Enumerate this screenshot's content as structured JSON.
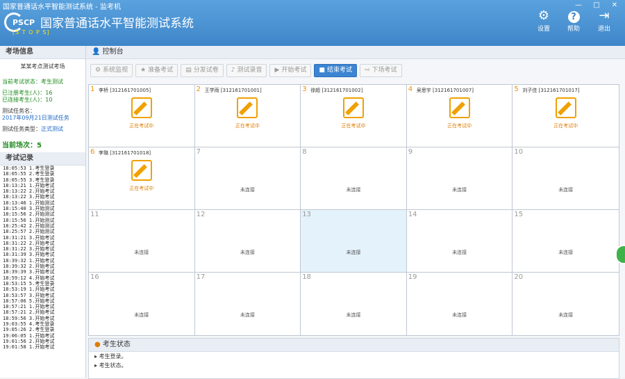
{
  "window": {
    "title": "国家普通话水平智能测试系统 - 监考机",
    "min": "—",
    "max": "□",
    "close": "✕"
  },
  "app": {
    "logo": "PSCP",
    "title": "国家普通话水平智能测试系统",
    "subtitle": "[S T O P S]"
  },
  "header_buttons": [
    {
      "label": "设置",
      "icon": "gear-icon",
      "glyph": "⚙"
    },
    {
      "label": "帮助",
      "icon": "help-icon",
      "glyph": "?"
    },
    {
      "label": "退出",
      "icon": "exit-icon",
      "glyph": "⇥"
    }
  ],
  "left": {
    "section_title": "考场信息",
    "room_name": "某某考点测试考场",
    "status_label": "当前考试状态：考生测试",
    "registered": "已注册考生(人)：16",
    "connected": "已连接考生(人)：10",
    "task_label": "测试任务名：",
    "task_value": "2017年09月21日测试任务",
    "type_label": "测试任务类型：",
    "type_value": "正式测试",
    "current_session": "当前场次：5",
    "log_title": "考试记录",
    "log": [
      "18:05:53 1.考生登录",
      "18:05:55 2.考生登录",
      "18:05:55 3.考生登录",
      "18:13:21 1.开始考试",
      "18:13:22 2.开始考试",
      "18:13:22 3.开始考试",
      "18:13:46 1.开始测试",
      "18:15:40 3.开始测试",
      "18:15:56 2.开始测试",
      "18:15:56 1.开始测试",
      "18:25:42 2.开始测试",
      "18:25:57 2.开始测试",
      "18:31:21 3.开始考试",
      "18:31:22 2.开始考试",
      "18:31:22 3.开始考试",
      "18:31:39 3.开始考试",
      "18:39:32 1.开始考试",
      "18:39:32 2.开始考试",
      "18:39:39 3.开始考试",
      "18:59:12 4.开始考试",
      "18:53:15 5.考生登录",
      "18:53:19 1.开始考试",
      "18:53:57 3.开始考试",
      "18:57:06 5.开始考试",
      "18:57:21 1.开始考试",
      "18:57:21 2.开始考试",
      "18:59:56 3.开始考试",
      "19:03:55 4.考生登录",
      "19:05:26 2.考生登录",
      "19:06:05 1.开始考试",
      "19:01:56 2.开始考试",
      "19:01:58 1.开始考试"
    ]
  },
  "control": {
    "title": "控制台"
  },
  "toolbar": [
    {
      "label": "系统监视",
      "icon": "gear-icon",
      "glyph": "⚙",
      "active": false
    },
    {
      "label": "准备考试",
      "icon": "star-icon",
      "glyph": "★",
      "active": false
    },
    {
      "label": "分发试卷",
      "icon": "document-icon",
      "glyph": "▤",
      "active": false
    },
    {
      "label": "测试录音",
      "icon": "microphone-icon",
      "glyph": "♪",
      "active": false
    },
    {
      "label": "开始考试",
      "icon": "play-icon",
      "glyph": "▶",
      "active": false
    },
    {
      "label": "结束考试",
      "icon": "stop-icon",
      "glyph": "■",
      "active": true
    },
    {
      "label": "下场考试",
      "icon": "next-icon",
      "glyph": "⇨",
      "active": false
    }
  ],
  "seat_status_active": "正在考试中",
  "seat_status_idle": "未连接",
  "seats": [
    {
      "num": "1",
      "active": true,
      "name": "李桥 [312161701005]"
    },
    {
      "num": "2",
      "active": true,
      "name": "王学雨 [312161701001]"
    },
    {
      "num": "3",
      "active": true,
      "name": "徐超 [312161701002]"
    },
    {
      "num": "4",
      "active": true,
      "name": "吴思宇 [312161701007]"
    },
    {
      "num": "5",
      "active": true,
      "name": "刘子佳 [312161701017]"
    },
    {
      "num": "6",
      "active": true,
      "name": "李璐 [312161701018]"
    },
    {
      "num": "7",
      "active": false,
      "name": ""
    },
    {
      "num": "8",
      "active": false,
      "name": ""
    },
    {
      "num": "9",
      "active": false,
      "name": ""
    },
    {
      "num": "10",
      "active": false,
      "name": ""
    },
    {
      "num": "11",
      "active": false,
      "name": ""
    },
    {
      "num": "12",
      "active": false,
      "name": ""
    },
    {
      "num": "13",
      "active": false,
      "name": "",
      "selected": true
    },
    {
      "num": "14",
      "active": false,
      "name": ""
    },
    {
      "num": "15",
      "active": false,
      "name": ""
    },
    {
      "num": "16",
      "active": false,
      "name": ""
    },
    {
      "num": "17",
      "active": false,
      "name": ""
    },
    {
      "num": "18",
      "active": false,
      "name": ""
    },
    {
      "num": "19",
      "active": false,
      "name": ""
    },
    {
      "num": "20",
      "active": false,
      "name": ""
    }
  ],
  "feedback": {
    "title": "考生状态",
    "items": [
      "考生登录。",
      "考生状态。"
    ]
  }
}
